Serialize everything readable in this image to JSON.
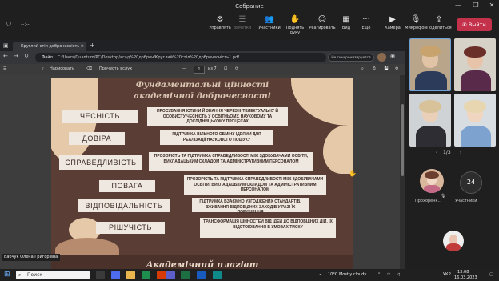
{
  "window": {
    "title": "Собрание"
  },
  "toolbar": {
    "timer": "--:--",
    "buttons": [
      {
        "label": "Управлять",
        "icon": "person-gear-icon"
      },
      {
        "label": "Заметки",
        "icon": "notes-icon"
      },
      {
        "label": "Участники",
        "icon": "people-icon"
      },
      {
        "label": "Поднять руку",
        "icon": "raise-hand-icon"
      },
      {
        "label": "Реагировать",
        "icon": "emoji-icon"
      },
      {
        "label": "Вид",
        "icon": "grid-icon"
      },
      {
        "label": "Еще",
        "icon": "more-icon"
      },
      {
        "label": "Камера",
        "icon": "camera-icon"
      },
      {
        "label": "Микрофон",
        "icon": "mic-off-icon"
      },
      {
        "label": "Поделиться",
        "icon": "share-icon"
      }
    ],
    "leave_label": "Выйти"
  },
  "browser": {
    "tab_title": "Круглий стіл доброчесність",
    "address_prefix": "Файл",
    "address": "C:/Users/Quantum/PC/Desktop/acaд%20доброч/Круглий%20стіл%20доброчесність1.pdf",
    "sync_label": "Не синхронизируется",
    "pdf": {
      "draw_label": "Нарисовать",
      "read_label": "Прочесть вслух",
      "page_current": "1",
      "page_total": "из 7"
    }
  },
  "slide": {
    "title_line1": "Фундаментальні цінності",
    "title_line2": "академічної доброчесності",
    "values": [
      "ЧЕСНІСТЬ",
      "ДОВІРА",
      "СПРАВЕДЛИВІСТЬ",
      "ПОВАГА",
      "ВІДПОВІДАЛЬНІСТЬ",
      "РІШУЧІСТЬ"
    ],
    "descriptions": [
      "ПРОСУВАННЯ ІСТИНИ Й ЗНАННЯ ЧЕРЕЗ ІНТЕЛЕКТУАЛЬНУ Й ОСОБИСТУ ЧЕСНІСТЬ У ОСВІТНЬОМУ, НАУКОВОМУ ТА ДОСЛІДНИЦЬКОМУ ПРОЦЕСАХ",
      "ПІДТРИМКА ВІЛЬНОГО ОБМІНУ ІДЕЯМИ ДЛЯ РЕАЛІЗАЦІЇ НАУКОВОГО ПОШУКУ",
      "ПРОЗОРІСТЬ ТА ПІДТРИМКА СПРАВЕДЛИВОСТІ МІЖ ЗДОБУВАЧАМИ ОСВІТИ, ВИКЛАДАЦЬКИМ СКЛАДОМ ТА АДМІНІСТРАТИВНИМ ПЕРСОНАЛОМ",
      "ПРОЗОРІСТЬ ТА ПІДТРИМКА СПРАВЕДЛИВОСТІ МІЖ ЗДОБУВАЧАМИ ОСВІТИ, ВИКЛАДАЦЬКИМ СКЛАДОМ ТА АДМІНІСТРАТИВНИМ ПЕРСОНАЛОМ",
      "ПІДТРИМКА ВЗАЄМНО УЗГОДЖЕНИХ СТАНДАРТІВ, ВЖИВАННЯ ВІДПОВІДНИХ ЗАХОДІВ У РАЗІ ЇХ ПОРУШЕННЯ",
      "ТРАНСФОРМАЦІЯ ЦІННОСТЕЙ ВІД ІДЕЙ ДО ВІДПОВІДНИХ ДІЙ, ЇХ ВІДСТОЮВАННЯ В УМОВАХ ТИСКУ"
    ],
    "bottom_title": "Академічний плагіат"
  },
  "presenter_name": "Бабчук Олена Григорівна",
  "participants": {
    "pager": "1/3",
    "attendee_name": "Прохоренк...",
    "count": "24",
    "count_label": "Участники"
  },
  "taskbar": {
    "search_label": "Поиск",
    "weather": "10°C  Mostly cloudy",
    "lang": "УКР",
    "time": "13:08",
    "date": "16.03.2023"
  }
}
